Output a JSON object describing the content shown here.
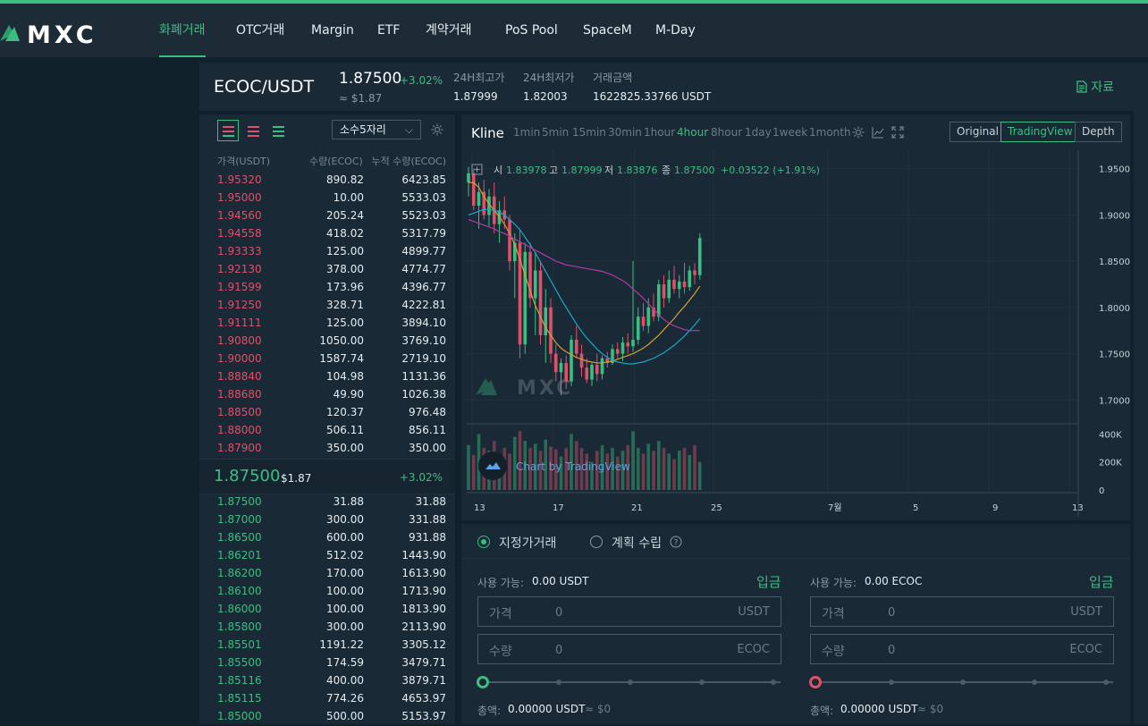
{
  "brand": {
    "logo_text": "MXC"
  },
  "nav": {
    "items": [
      "화폐거래",
      "OTC거래",
      "Margin",
      "ETF",
      "계약거래",
      "PoS Pool",
      "SpaceM",
      "M-Day"
    ]
  },
  "ticker": {
    "pair": "ECOC/USDT",
    "last_price": "1.87500",
    "change": "+3.02%",
    "usd_value": "≈ $1.87",
    "high_label": "24H최고가",
    "high": "1.87999",
    "low_label": "24H최저가",
    "low": "1.82003",
    "vol_label": "거래금액",
    "vol": "1622825.33766 USDT",
    "docs_label": "자료"
  },
  "orderbook": {
    "decimal_label": "소수5자리",
    "headers": [
      "가격(USDT)",
      "수량(ECOC)",
      "누적 수량(ECOC)"
    ],
    "asks": [
      [
        "1.95320",
        "890.82",
        "6423.85"
      ],
      [
        "1.95000",
        "10.00",
        "5533.03"
      ],
      [
        "1.94560",
        "205.24",
        "5523.03"
      ],
      [
        "1.94558",
        "418.02",
        "5317.79"
      ],
      [
        "1.93333",
        "125.00",
        "4899.77"
      ],
      [
        "1.92130",
        "378.00",
        "4774.77"
      ],
      [
        "1.91599",
        "173.96",
        "4396.77"
      ],
      [
        "1.91250",
        "328.71",
        "4222.81"
      ],
      [
        "1.91111",
        "125.00",
        "3894.10"
      ],
      [
        "1.90800",
        "1050.00",
        "3769.10"
      ],
      [
        "1.90000",
        "1587.74",
        "2719.10"
      ],
      [
        "1.88840",
        "104.98",
        "1131.36"
      ],
      [
        "1.88680",
        "49.90",
        "1026.38"
      ],
      [
        "1.88500",
        "120.37",
        "976.48"
      ],
      [
        "1.88000",
        "506.11",
        "856.11"
      ],
      [
        "1.87900",
        "350.00",
        "350.00"
      ]
    ],
    "mid_price": "1.87500",
    "mid_usd": "$1.87",
    "mid_change": "+3.02%",
    "bids": [
      [
        "1.87500",
        "31.88",
        "31.88"
      ],
      [
        "1.87000",
        "300.00",
        "331.88"
      ],
      [
        "1.86500",
        "600.00",
        "931.88"
      ],
      [
        "1.86201",
        "512.02",
        "1443.90"
      ],
      [
        "1.86200",
        "170.00",
        "1613.90"
      ],
      [
        "1.86100",
        "100.00",
        "1713.90"
      ],
      [
        "1.86000",
        "100.00",
        "1813.90"
      ],
      [
        "1.85800",
        "300.00",
        "2113.90"
      ],
      [
        "1.85501",
        "1191.22",
        "3305.12"
      ],
      [
        "1.85500",
        "174.59",
        "3479.71"
      ],
      [
        "1.85116",
        "400.00",
        "3879.71"
      ],
      [
        "1.85115",
        "774.26",
        "4653.97"
      ],
      [
        "1.85000",
        "500.00",
        "5153.97"
      ]
    ]
  },
  "chart": {
    "title": "Kline",
    "intervals": [
      "1min",
      "5min",
      "15min",
      "30min",
      "1hour",
      "4hour",
      "8hour",
      "1day",
      "1week",
      "1month"
    ],
    "active_interval": "4hour",
    "modes": [
      "Original",
      "TradingView",
      "Depth"
    ],
    "active_mode": "TradingView",
    "legend": {
      "o_label": "시",
      "o": "1.83978",
      "h_label": "고",
      "h": "1.87999",
      "l_label": "저",
      "l": "1.83876",
      "c_label": "종",
      "c": "1.87500",
      "chg": "+0.03522 (+1.91%)"
    },
    "watermark": "MXC",
    "attribution": "Chart by TradingView",
    "price_ticks": [
      "1.95000",
      "1.90000",
      "1.85000",
      "1.80000",
      "1.75000",
      "1.70000"
    ],
    "volume_ticks": [
      "400K",
      "200K",
      "0"
    ],
    "time_ticks": [
      "13",
      "17",
      "21",
      "25",
      "7월",
      "5",
      "9",
      "13"
    ]
  },
  "chart_data": {
    "type": "candlestick",
    "title": "",
    "interval": "4hour",
    "ylim": [
      1.68,
      1.97
    ],
    "volume_ylim": [
      0,
      460000
    ],
    "x_labels": [
      "13",
      "17",
      "21",
      "25",
      "7월",
      "5",
      "9",
      "13"
    ],
    "candles": [
      {
        "o": 1.935,
        "h": 1.952,
        "l": 1.92,
        "c": 1.945
      },
      {
        "o": 1.945,
        "h": 1.95,
        "l": 1.905,
        "c": 1.91
      },
      {
        "o": 1.91,
        "h": 1.935,
        "l": 1.885,
        "c": 1.925
      },
      {
        "o": 1.925,
        "h": 1.938,
        "l": 1.895,
        "c": 1.9
      },
      {
        "o": 1.9,
        "h": 1.928,
        "l": 1.888,
        "c": 1.92
      },
      {
        "o": 1.92,
        "h": 1.935,
        "l": 1.88,
        "c": 1.89
      },
      {
        "o": 1.89,
        "h": 1.915,
        "l": 1.87,
        "c": 1.905
      },
      {
        "o": 1.905,
        "h": 1.92,
        "l": 1.885,
        "c": 1.895
      },
      {
        "o": 1.895,
        "h": 1.9,
        "l": 1.84,
        "c": 1.85
      },
      {
        "o": 1.85,
        "h": 1.88,
        "l": 1.81,
        "c": 1.87
      },
      {
        "o": 1.87,
        "h": 1.885,
        "l": 1.745,
        "c": 1.76
      },
      {
        "o": 1.76,
        "h": 1.87,
        "l": 1.75,
        "c": 1.86
      },
      {
        "o": 1.86,
        "h": 1.87,
        "l": 1.8,
        "c": 1.81
      },
      {
        "o": 1.81,
        "h": 1.86,
        "l": 1.77,
        "c": 1.84
      },
      {
        "o": 1.84,
        "h": 1.85,
        "l": 1.76,
        "c": 1.77
      },
      {
        "o": 1.77,
        "h": 1.82,
        "l": 1.74,
        "c": 1.8
      },
      {
        "o": 1.8,
        "h": 1.81,
        "l": 1.74,
        "c": 1.75
      },
      {
        "o": 1.75,
        "h": 1.76,
        "l": 1.72,
        "c": 1.73
      },
      {
        "o": 1.73,
        "h": 1.745,
        "l": 1.705,
        "c": 1.74
      },
      {
        "o": 1.74,
        "h": 1.748,
        "l": 1.712,
        "c": 1.72
      },
      {
        "o": 1.72,
        "h": 1.77,
        "l": 1.715,
        "c": 1.765
      },
      {
        "o": 1.765,
        "h": 1.78,
        "l": 1.745,
        "c": 1.75
      },
      {
        "o": 1.75,
        "h": 1.76,
        "l": 1.725,
        "c": 1.735
      },
      {
        "o": 1.735,
        "h": 1.745,
        "l": 1.718,
        "c": 1.722
      },
      {
        "o": 1.722,
        "h": 1.74,
        "l": 1.715,
        "c": 1.738
      },
      {
        "o": 1.738,
        "h": 1.75,
        "l": 1.72,
        "c": 1.728
      },
      {
        "o": 1.728,
        "h": 1.748,
        "l": 1.722,
        "c": 1.745
      },
      {
        "o": 1.745,
        "h": 1.752,
        "l": 1.735,
        "c": 1.74
      },
      {
        "o": 1.74,
        "h": 1.76,
        "l": 1.738,
        "c": 1.755
      },
      {
        "o": 1.755,
        "h": 1.762,
        "l": 1.745,
        "c": 1.75
      },
      {
        "o": 1.75,
        "h": 1.768,
        "l": 1.742,
        "c": 1.762
      },
      {
        "o": 1.762,
        "h": 1.772,
        "l": 1.75,
        "c": 1.758
      },
      {
        "o": 1.758,
        "h": 1.85,
        "l": 1.752,
        "c": 1.765
      },
      {
        "o": 1.765,
        "h": 1.8,
        "l": 1.76,
        "c": 1.79
      },
      {
        "o": 1.79,
        "h": 1.805,
        "l": 1.775,
        "c": 1.78
      },
      {
        "o": 1.78,
        "h": 1.81,
        "l": 1.772,
        "c": 1.8
      },
      {
        "o": 1.8,
        "h": 1.815,
        "l": 1.785,
        "c": 1.79
      },
      {
        "o": 1.79,
        "h": 1.83,
        "l": 1.785,
        "c": 1.825
      },
      {
        "o": 1.825,
        "h": 1.835,
        "l": 1.8,
        "c": 1.81
      },
      {
        "o": 1.81,
        "h": 1.84,
        "l": 1.805,
        "c": 1.83
      },
      {
        "o": 1.83,
        "h": 1.845,
        "l": 1.815,
        "c": 1.82
      },
      {
        "o": 1.82,
        "h": 1.835,
        "l": 1.81,
        "c": 1.828
      },
      {
        "o": 1.828,
        "h": 1.848,
        "l": 1.815,
        "c": 1.822
      },
      {
        "o": 1.822,
        "h": 1.845,
        "l": 1.818,
        "c": 1.84
      },
      {
        "o": 1.84,
        "h": 1.848,
        "l": 1.825,
        "c": 1.835
      },
      {
        "o": 1.835,
        "h": 1.88,
        "l": 1.83,
        "c": 1.875
      }
    ],
    "volumes": [
      320000,
      250000,
      400000,
      300000,
      280000,
      350000,
      220000,
      300000,
      260000,
      380000,
      420000,
      350000,
      300000,
      330000,
      280000,
      360000,
      310000,
      290000,
      240000,
      300000,
      400000,
      350000,
      300000,
      260000,
      200000,
      280000,
      320000,
      260000,
      300000,
      240000,
      280000,
      320000,
      420000,
      300000,
      260000,
      330000,
      280000,
      350000,
      300000,
      260000,
      220000,
      280000,
      300000,
      250000,
      320000,
      200000
    ],
    "ma_series": [
      {
        "color": "#d4a03a",
        "values": [
          1.935,
          1.935,
          1.93,
          1.92,
          1.912,
          1.905,
          1.898,
          1.89,
          1.88,
          1.868,
          1.852,
          1.835,
          1.818,
          1.802,
          1.79,
          1.778,
          1.77,
          1.762,
          1.756,
          1.752,
          1.749,
          1.746,
          1.744,
          1.742,
          1.741,
          1.74,
          1.74,
          1.741,
          1.742,
          1.744,
          1.746,
          1.748,
          1.75,
          1.753,
          1.756,
          1.76,
          1.765,
          1.77,
          1.776,
          1.782,
          1.788,
          1.795,
          1.801,
          1.808,
          1.815,
          1.823
        ]
      },
      {
        "color": "#1ea7c8",
        "values": [
          1.9,
          1.902,
          1.904,
          1.906,
          1.906,
          1.905,
          1.903,
          1.9,
          1.895,
          1.89,
          1.884,
          1.876,
          1.868,
          1.859,
          1.849,
          1.839,
          1.829,
          1.819,
          1.809,
          1.8,
          1.791,
          1.782,
          1.774,
          1.767,
          1.761,
          1.755,
          1.75,
          1.746,
          1.743,
          1.741,
          1.74,
          1.739,
          1.739,
          1.74,
          1.741,
          1.743,
          1.745,
          1.748,
          1.751,
          1.755,
          1.759,
          1.764,
          1.769,
          1.775,
          1.781,
          1.788
        ]
      },
      {
        "color": "#b03aa8",
        "values": [
          1.895,
          1.893,
          1.891,
          1.889,
          1.887,
          1.885,
          1.882,
          1.88,
          1.877,
          1.874,
          1.871,
          1.868,
          1.865,
          1.862,
          1.859,
          1.856,
          1.853,
          1.85,
          1.848,
          1.846,
          1.845,
          1.844,
          1.843,
          1.842,
          1.841,
          1.84,
          1.839,
          1.837,
          1.835,
          1.832,
          1.829,
          1.825,
          1.82,
          1.815,
          1.81,
          1.804,
          1.798,
          1.792,
          1.787,
          1.783,
          1.78,
          1.778,
          1.776,
          1.775,
          1.775,
          1.775
        ]
      }
    ]
  },
  "order": {
    "type_limit": "지정가거래",
    "type_plan": "계획 수립",
    "buy": {
      "avail_label": "사용 가능:",
      "avail": "0.00 USDT",
      "deposit": "입금",
      "price_label": "가격",
      "price": "0",
      "price_unit": "USDT",
      "qty_label": "수량",
      "qty": "0",
      "qty_unit": "ECOC",
      "total_label": "총액:",
      "total": "0.00000 USDT",
      "total_usd": "≈ $0"
    },
    "sell": {
      "avail_label": "사용 가능:",
      "avail": "0.00 ECOC",
      "deposit": "입금",
      "price_label": "가격",
      "price": "0",
      "price_unit": "USDT",
      "qty_label": "수량",
      "qty": "0",
      "qty_unit": "ECOC",
      "total_label": "총액:",
      "total": "0.00000 USDT",
      "total_usd": "≈ $0"
    }
  },
  "colors": {
    "up": "#3cbe82",
    "down": "#e0506a",
    "accent": "#3cbe82",
    "panel": "#192935",
    "bg": "#10212b"
  }
}
